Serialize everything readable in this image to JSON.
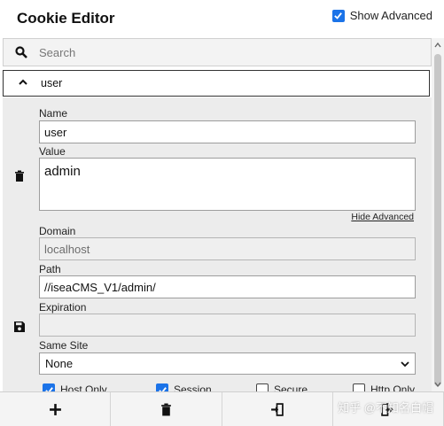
{
  "header": {
    "title": "Cookie Editor",
    "show_advanced_label": "Show Advanced",
    "show_advanced_checked": true
  },
  "search": {
    "placeholder": "Search",
    "value": ""
  },
  "cookie": {
    "name_heading": "user",
    "fields": {
      "name_label": "Name",
      "name_value": "user",
      "value_label": "Value",
      "value_value": "admin",
      "hide_advanced": "Hide Advanced",
      "domain_label": "Domain",
      "domain_value": "localhost",
      "path_label": "Path",
      "path_value": "//iseaCMS_V1/admin/",
      "expiration_label": "Expiration",
      "expiration_value": "",
      "same_site_label": "Same Site",
      "same_site_value": "None"
    },
    "flags": [
      {
        "label": "Host Only",
        "checked": true
      },
      {
        "label": "Session",
        "checked": true
      },
      {
        "label": "Secure",
        "checked": false
      },
      {
        "label": "Http Only",
        "checked": false
      }
    ]
  },
  "toolbar": {
    "buttons": [
      "add-icon",
      "trash-icon",
      "import-icon",
      "export-icon"
    ]
  },
  "watermark": "知乎 @不知名白帽",
  "colors": {
    "accent": "#1b73e8",
    "panel": "#ececec"
  }
}
